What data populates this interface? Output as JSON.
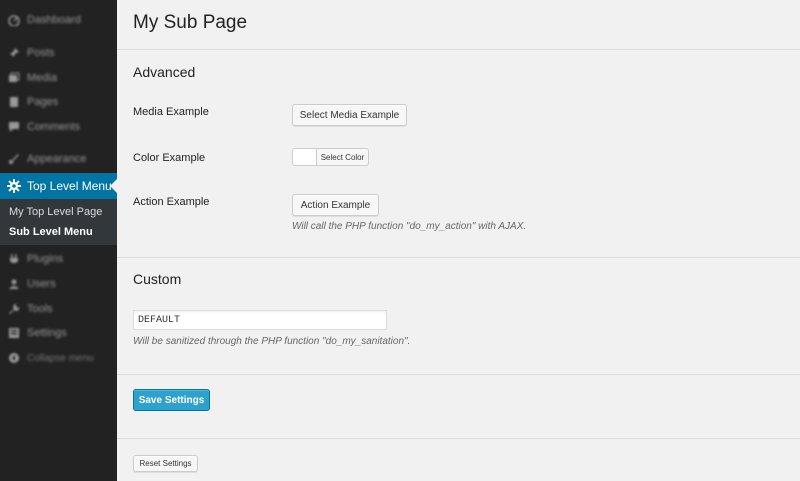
{
  "sidebar": {
    "items": [
      {
        "label": "Dashboard",
        "icon": "dashboard-icon"
      },
      {
        "label": "Posts",
        "icon": "pin-icon"
      },
      {
        "label": "Media",
        "icon": "media-icon"
      },
      {
        "label": "Pages",
        "icon": "pages-icon"
      },
      {
        "label": "Comments",
        "icon": "comment-icon"
      },
      {
        "label": "Appearance",
        "icon": "paintbrush-icon"
      },
      {
        "label": "Top Level Menu",
        "icon": "gear-icon"
      },
      {
        "label": "Plugins",
        "icon": "plug-icon"
      },
      {
        "label": "Users",
        "icon": "user-icon"
      },
      {
        "label": "Tools",
        "icon": "wrench-icon"
      },
      {
        "label": "Settings",
        "icon": "settings-icon"
      },
      {
        "label": "Collapse menu",
        "icon": "collapse-icon"
      }
    ],
    "submenu": [
      "My Top Level Page",
      "Sub Level Menu"
    ]
  },
  "page": {
    "title": "My Sub Page",
    "advanced": {
      "title": "Advanced",
      "media_label": "Media Example",
      "media_button": "Select Media Example",
      "color_label": "Color Example",
      "color_button": "Select Color",
      "action_label": "Action Example",
      "action_button": "Action Example",
      "action_desc": "Will call the PHP function \"do_my_action\" with AJAX."
    },
    "custom": {
      "title": "Custom",
      "input_value": "DEFAULT",
      "input_desc": "Will be sanitized through the PHP function \"do_my_sanitation\"."
    },
    "save_label": "Save Settings",
    "reset_label": "Reset Settings"
  },
  "colors": {
    "sidebar_bg": "#222222",
    "active_bg": "#0074a2",
    "primary_button": "#2ea2cc",
    "swatch": "#ffffff"
  }
}
